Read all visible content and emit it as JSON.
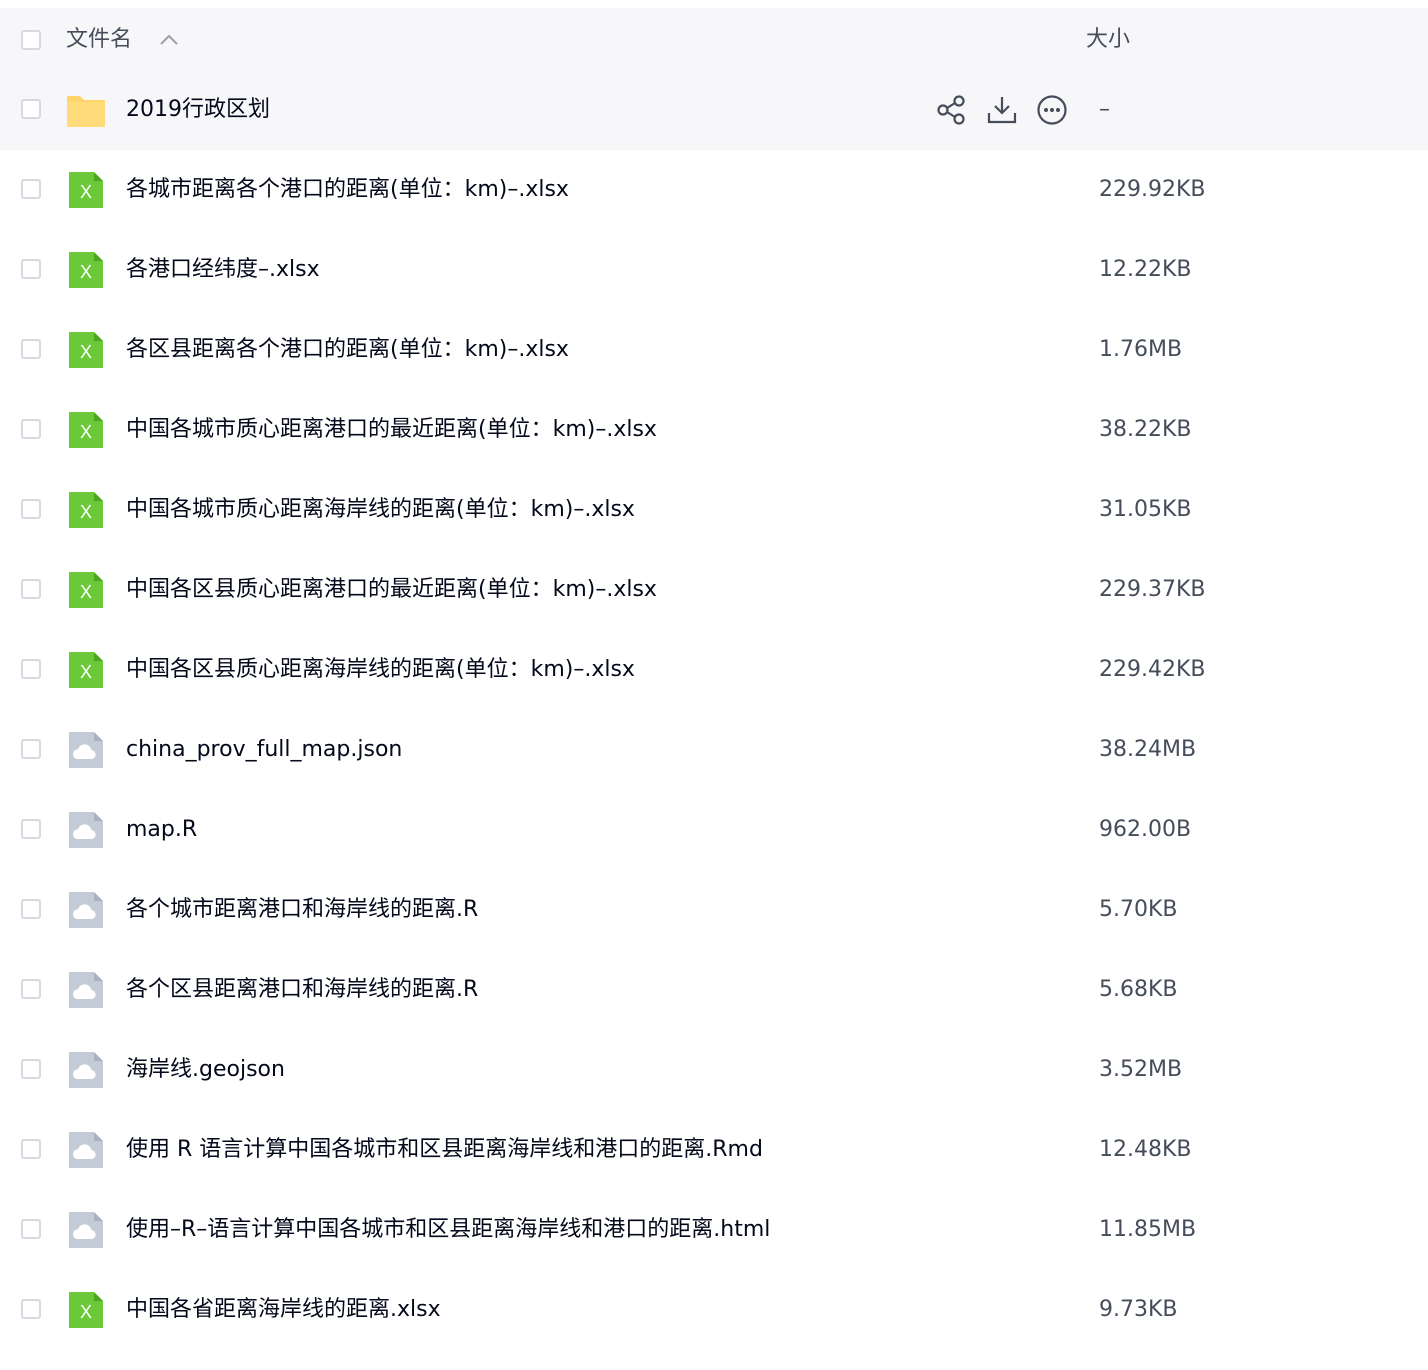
{
  "header": {
    "name_label": "文件名",
    "size_label": "大小",
    "sort_direction": "ascending"
  },
  "colors": {
    "header_bg": "#f7f7f9",
    "hover_bg": "#f7f7f9",
    "folder_yellow": "#ffd46a",
    "excel_green": "#6bc839",
    "generic_file_gray": "#c3cbd6",
    "text_primary": "#03081a",
    "text_secondary": "#454d5a"
  },
  "folder": {
    "name": "2019行政区划",
    "size": "–",
    "icon": "folder-icon",
    "actions": [
      "share-icon",
      "download-icon",
      "more-icon"
    ]
  },
  "files": [
    {
      "name": "各城市距离各个港口的距离(单位：km)–.xlsx",
      "size": "229.92KB",
      "icon": "excel-icon"
    },
    {
      "name": "各港口经纬度–.xlsx",
      "size": "12.22KB",
      "icon": "excel-icon"
    },
    {
      "name": "各区县距离各个港口的距离(单位：km)–.xlsx",
      "size": "1.76MB",
      "icon": "excel-icon"
    },
    {
      "name": "中国各城市质心距离港口的最近距离(单位：km)–.xlsx",
      "size": "38.22KB",
      "icon": "excel-icon"
    },
    {
      "name": "中国各城市质心距离海岸线的距离(单位：km)–.xlsx",
      "size": "31.05KB",
      "icon": "excel-icon"
    },
    {
      "name": "中国各区县质心距离港口的最近距离(单位：km)–.xlsx",
      "size": "229.37KB",
      "icon": "excel-icon"
    },
    {
      "name": "中国各区县质心距离海岸线的距离(单位：km)–.xlsx",
      "size": "229.42KB",
      "icon": "excel-icon"
    },
    {
      "name": "china_prov_full_map.json",
      "size": "38.24MB",
      "icon": "cloud-file-icon"
    },
    {
      "name": "map.R",
      "size": "962.00B",
      "icon": "cloud-file-icon"
    },
    {
      "name": "各个城市距离港口和海岸线的距离.R",
      "size": "5.70KB",
      "icon": "cloud-file-icon"
    },
    {
      "name": "各个区县距离港口和海岸线的距离.R",
      "size": "5.68KB",
      "icon": "cloud-file-icon"
    },
    {
      "name": "海岸线.geojson",
      "size": "3.52MB",
      "icon": "cloud-file-icon"
    },
    {
      "name": "使用 R 语言计算中国各城市和区县距离海岸线和港口的距离.Rmd",
      "size": "12.48KB",
      "icon": "cloud-file-icon"
    },
    {
      "name": "使用–R–语言计算中国各城市和区县距离海岸线和港口的距离.html",
      "size": "11.85MB",
      "icon": "cloud-file-icon"
    },
    {
      "name": "中国各省距离海岸线的距离.xlsx",
      "size": "9.73KB",
      "icon": "excel-icon"
    }
  ]
}
